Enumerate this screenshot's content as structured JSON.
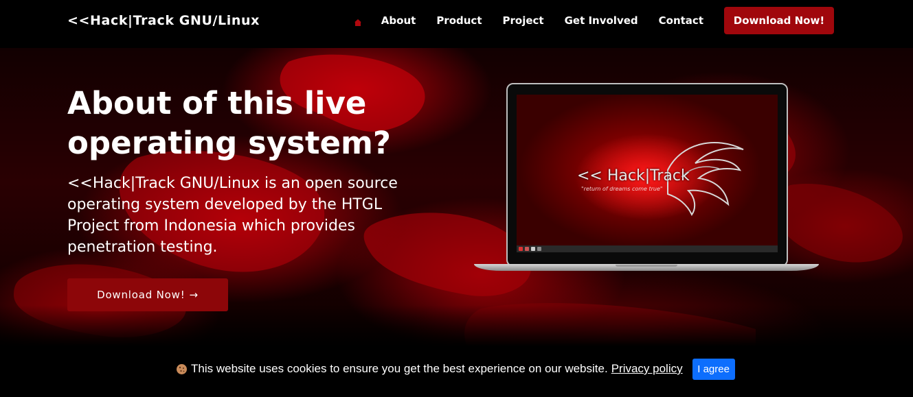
{
  "brand": "<<Hack|Track GNU/Linux",
  "nav": {
    "home_icon": "home-icon",
    "links": [
      "About",
      "Product",
      "Project",
      "Get Involved",
      "Contact"
    ],
    "cta_label": "Download Now!"
  },
  "hero": {
    "title": "About of this live operating system?",
    "description": "<<Hack|Track GNU/Linux is an open source operating system developed by the HTGL Project from Indonesia which provides penetration testing.",
    "button_label": "Download Now!",
    "button_arrow": "→"
  },
  "laptop_screen": {
    "logo_text": "<< Hack|Track",
    "tagline": "\"return of dreams come true\""
  },
  "cookie": {
    "text": "This website uses cookies to ensure you get the best experience on our website.",
    "link_label": "Privacy policy",
    "button_label": "I agree"
  },
  "colors": {
    "accent": "#a0070c",
    "hero_button": "#8d0609",
    "agree_button": "#0d6efd",
    "background": "#000000"
  }
}
